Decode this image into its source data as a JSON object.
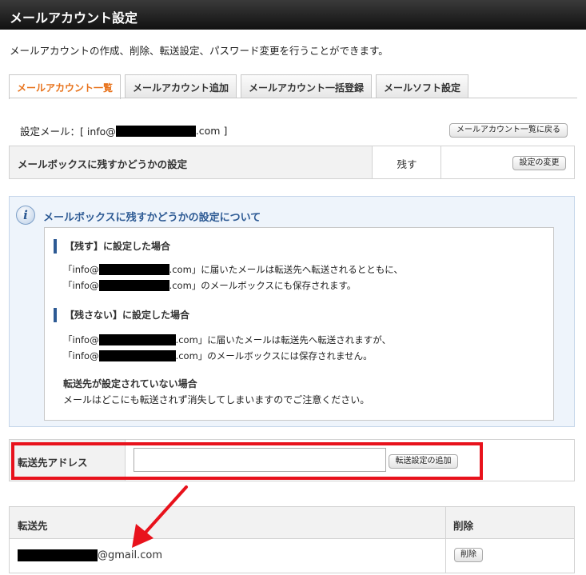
{
  "header": {
    "title": "メールアカウント設定"
  },
  "description": "メールアカウントの作成、削除、転送設定、パスワード変更を行うことができます。",
  "tabs": [
    {
      "label": "メールアカウント一覧",
      "active": true
    },
    {
      "label": "メールアカウント追加",
      "active": false
    },
    {
      "label": "メールアカウント一括登録",
      "active": false
    },
    {
      "label": "メールソフト設定",
      "active": false
    }
  ],
  "setting_mail": {
    "prefix": "設定メール：[ info@",
    "suffix": ".com ]",
    "back_button": "メールアカウント一覧に戻る"
  },
  "mailbox_setting": {
    "label": "メールボックスに残すかどうかの設定",
    "value": "残す",
    "change_button": "設定の変更"
  },
  "info": {
    "title": "メールボックスに残すかどうかの設定について",
    "keep": {
      "heading": "【残す】に設定した場合",
      "line1_prefix": "「info@",
      "line1_suffix": ".com」に届いたメールは転送先へ転送されるとともに、",
      "line2_prefix": "「info@",
      "line2_suffix": ".com」のメールボックスにも保存されます。"
    },
    "nokeep": {
      "heading": "【残さない】に設定した場合",
      "line1_prefix": "「info@",
      "line1_suffix": ".com」に届いたメールは転送先へ転送されますが、",
      "line2_prefix": "「info@",
      "line2_suffix": ".com」のメールボックスには保存されません。"
    },
    "no_forward": {
      "heading": "転送先が設定されていない場合",
      "text": "メールはどこにも転送されず消失してしまいますのでご注意ください。"
    }
  },
  "forward_form": {
    "label": "転送先アドレス",
    "input_value": "",
    "add_button": "転送設定の追加"
  },
  "forward_list": {
    "col_dest": "転送先",
    "col_delete": "削除",
    "rows": [
      {
        "address_suffix": "@gmail.com",
        "delete_button": "削除"
      }
    ]
  },
  "colors": {
    "accent_orange": "#e8731c",
    "info_blue": "#2d5a94",
    "highlight_red": "#e8121c"
  }
}
